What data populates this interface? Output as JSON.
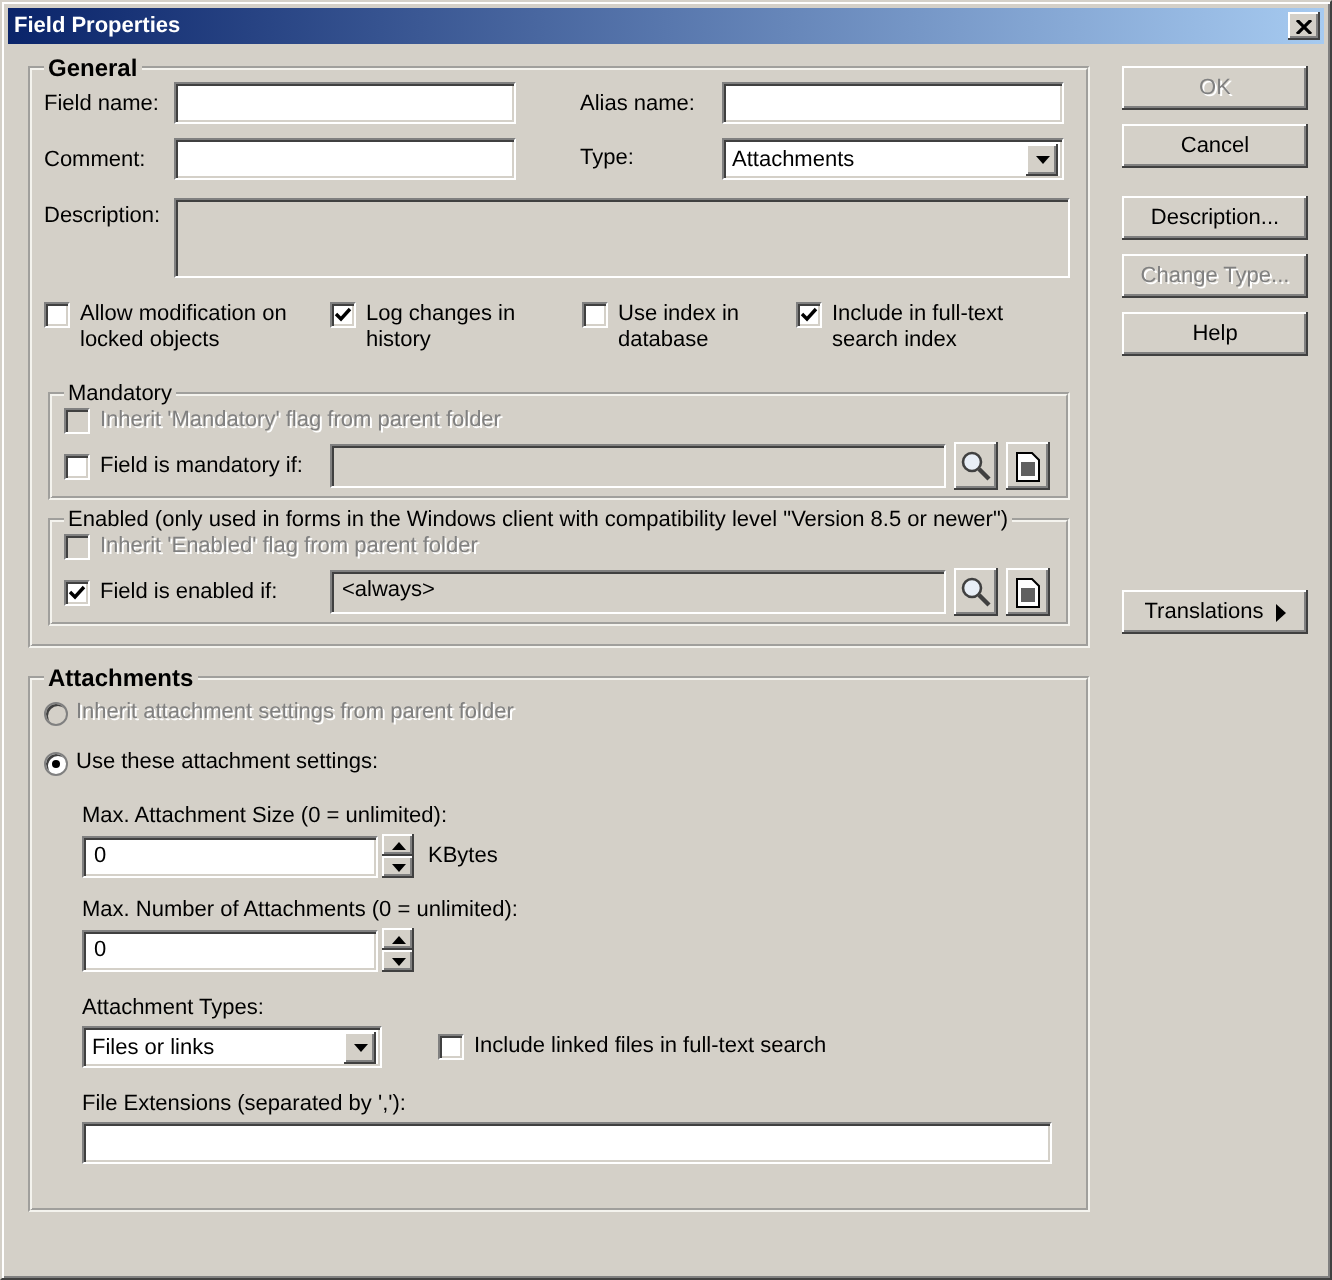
{
  "window": {
    "title": "Field Properties"
  },
  "general": {
    "title": "General",
    "fields": [
      {
        "label": "Field name:",
        "kind": "text"
      },
      {
        "label": "Alias name:",
        "kind": "text"
      },
      {
        "label": "Comment:",
        "kind": "text"
      },
      {
        "label": "Type:",
        "kind": "select",
        "value": "Attachments"
      }
    ],
    "description": {
      "label": "Description:",
      "disabled": true
    },
    "options": [
      {
        "label": "Allow modification on locked objects",
        "checked": false
      },
      {
        "label": "Log changes in history",
        "checked": true
      },
      {
        "label": "Use index in database",
        "checked": false
      },
      {
        "label": "Include in full-text search index",
        "checked": true
      }
    ],
    "groups": [
      {
        "title": "Mandatory",
        "inherit": {
          "label": "Inherit 'Mandatory' flag from parent folder",
          "checked": false,
          "disabled": true
        },
        "condition": {
          "label": "Field is mandatory if:",
          "checked": false
        }
      },
      {
        "title": "Enabled (only used in forms in the Windows client with compatibility level \"Version 8.5 or newer\")",
        "inherit": {
          "label": "Inherit 'Enabled' flag from parent folder",
          "checked": false,
          "disabled": true
        },
        "condition": {
          "label": "Field is enabled if:",
          "checked": true,
          "value": "<always>"
        }
      }
    ]
  },
  "attachments": {
    "title": "Attachments",
    "radios": [
      {
        "label": "Inherit attachment settings from parent folder",
        "selected": false,
        "disabled": true
      },
      {
        "label": "Use these attachment settings:",
        "selected": true,
        "disabled": false
      }
    ],
    "size": {
      "label": "Max. Attachment Size (0 = unlimited):",
      "value": "0",
      "unit": "KBytes"
    },
    "count": {
      "label": "Max. Number of Attachments (0 = unlimited):",
      "value": "0"
    },
    "types": {
      "label": "Attachment Types:",
      "value": "Files or links"
    },
    "linked": {
      "label": "Include linked files in full-text search",
      "checked": false
    },
    "extensions": {
      "label": "File Extensions (separated by ','):"
    }
  },
  "buttons": [
    {
      "label": "OK",
      "disabled": true
    },
    {
      "label": "Cancel",
      "disabled": false
    },
    {
      "label": "Description...",
      "disabled": false
    },
    {
      "label": "Change Type...",
      "disabled": true
    },
    {
      "label": "Help",
      "disabled": false
    }
  ],
  "translations": {
    "label": "Translations"
  }
}
